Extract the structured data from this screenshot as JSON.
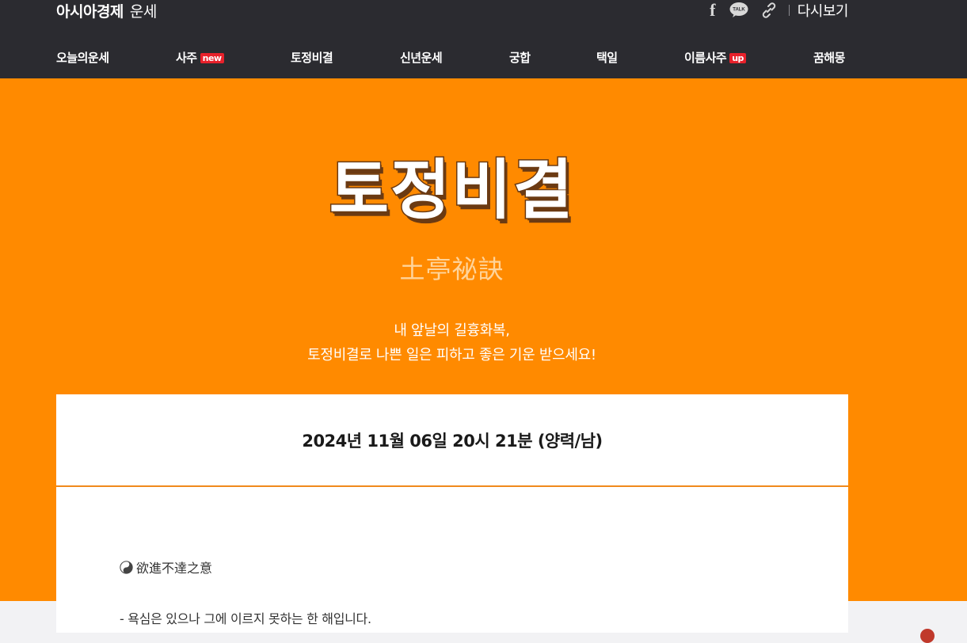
{
  "header": {
    "brand_main": "아시아경제",
    "brand_sub": "운세",
    "facebook_glyph": "f",
    "talk_label": "TALK",
    "replay_label": "다시보기"
  },
  "nav": {
    "items": [
      {
        "label": "오늘의운세"
      },
      {
        "label": "사주",
        "badge": "new"
      },
      {
        "label": "토정비결"
      },
      {
        "label": "신년운세"
      },
      {
        "label": "궁합"
      },
      {
        "label": "택일"
      },
      {
        "label": "이름사주",
        "badge": "up"
      },
      {
        "label": "꿈해몽"
      }
    ]
  },
  "hero": {
    "title": "토정비결",
    "hanja": "土亭祕訣",
    "desc_line1": "내 앞날의 길흉화복,",
    "desc_line2": "토정비결로 나쁜 일은 피하고 좋은 기운 받으세요!"
  },
  "result": {
    "date": "2024년 11월 06일 20시 21분 (양력/남)",
    "heading_hanja": "欲進不達之意",
    "body_line": "- 욕심은 있으나 그에 이르지 못하는 한 해입니다."
  },
  "colors": {
    "header_bg": "#2b2b30",
    "hero_bg": "#ff8a00",
    "badge": "#e8212b",
    "divider": "#f08a1c"
  },
  "icons": [
    "facebook-icon",
    "kakaotalk-icon",
    "link-icon",
    "yinyang-icon"
  ]
}
